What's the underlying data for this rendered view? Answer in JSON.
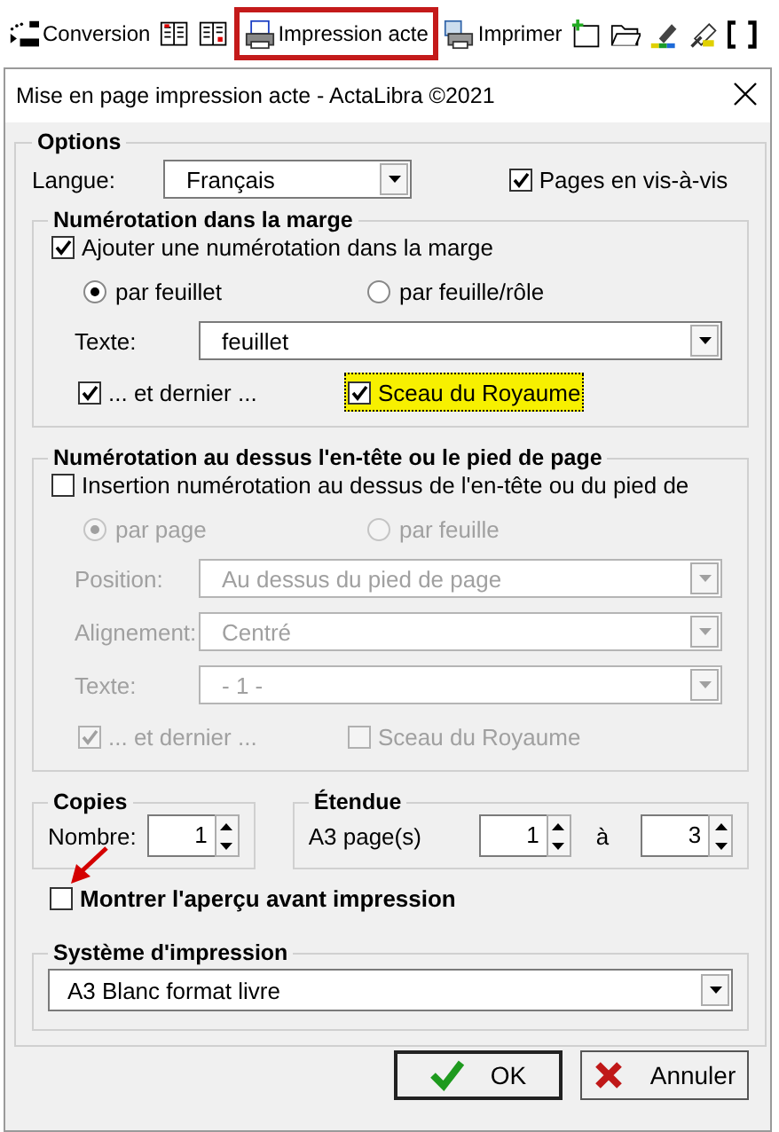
{
  "toolbar": [
    {
      "label": "Conversion",
      "highlighted": false
    },
    {
      "highlighted": false
    },
    {
      "highlighted": false
    },
    {
      "label": "Impression acte",
      "highlighted": true
    },
    {
      "label": "Imprimer",
      "highlighted": false
    },
    {
      "highlighted": false
    },
    {
      "highlighted": false
    },
    {
      "highlighted": false
    },
    {
      "highlighted": false
    },
    {
      "highlighted": false
    }
  ],
  "dialog": {
    "title": "Mise en page impression acte - ActaLibra ©2021",
    "options": {
      "title": "Options",
      "language": {
        "label": "Langue:",
        "value": "Français"
      },
      "facing_pages": {
        "label": "Pages en vis-à-vis",
        "checked": true
      },
      "margin_numbering": {
        "title": "Numérotation dans la marge",
        "enable": {
          "label": "Ajouter une numérotation dans la marge",
          "checked": true
        },
        "mode": [
          {
            "label": "par feuillet",
            "selected": true
          },
          {
            "label": "par feuille/rôle",
            "selected": false
          }
        ],
        "fields": [
          {
            "label": "Texte:",
            "value": "feuillet",
            "disabled": false
          }
        ],
        "last": {
          "label": "... et dernier ...",
          "checked": true,
          "disabled": false
        },
        "seal": {
          "label": "Sceau du Royaume",
          "checked": true,
          "disabled": false,
          "highlighted": true
        }
      },
      "header_numbering": {
        "title": "Numérotation au dessus l'en-tête ou le pied de page",
        "enable": {
          "label": "Insertion numérotation au dessus de l'en-tête ou du pied de",
          "checked": false
        },
        "mode": [
          {
            "label": "par page",
            "selected": true,
            "disabled": true
          },
          {
            "label": "par feuille",
            "selected": false,
            "disabled": true
          }
        ],
        "fields": [
          {
            "label": "Position:",
            "value": "Au dessus du pied de page",
            "disabled": true
          },
          {
            "label": "Alignement:",
            "value": "Centré",
            "disabled": true
          },
          {
            "label": "Texte:",
            "value": "- 1 -",
            "disabled": true
          }
        ],
        "last": {
          "label": "... et dernier ...",
          "checked": true,
          "disabled": true
        },
        "seal": {
          "label": "Sceau du Royaume",
          "checked": false,
          "disabled": true,
          "highlighted": false
        }
      },
      "copies": {
        "title": "Copies",
        "label": "Nombre:",
        "value": "1"
      },
      "range": {
        "title": "Étendue",
        "label": "A3 page(s)",
        "from": "1",
        "separator": "à",
        "to": "3"
      },
      "preview": {
        "label": "Montrer l'aperçu avant impression",
        "checked": false,
        "annotated": true
      },
      "print_system": {
        "title": "Système d'impression",
        "value": "A3 Blanc format livre"
      }
    },
    "buttons": [
      {
        "kind": "ok",
        "label": "OK"
      },
      {
        "kind": "cancel",
        "label": "Annuler"
      }
    ]
  }
}
